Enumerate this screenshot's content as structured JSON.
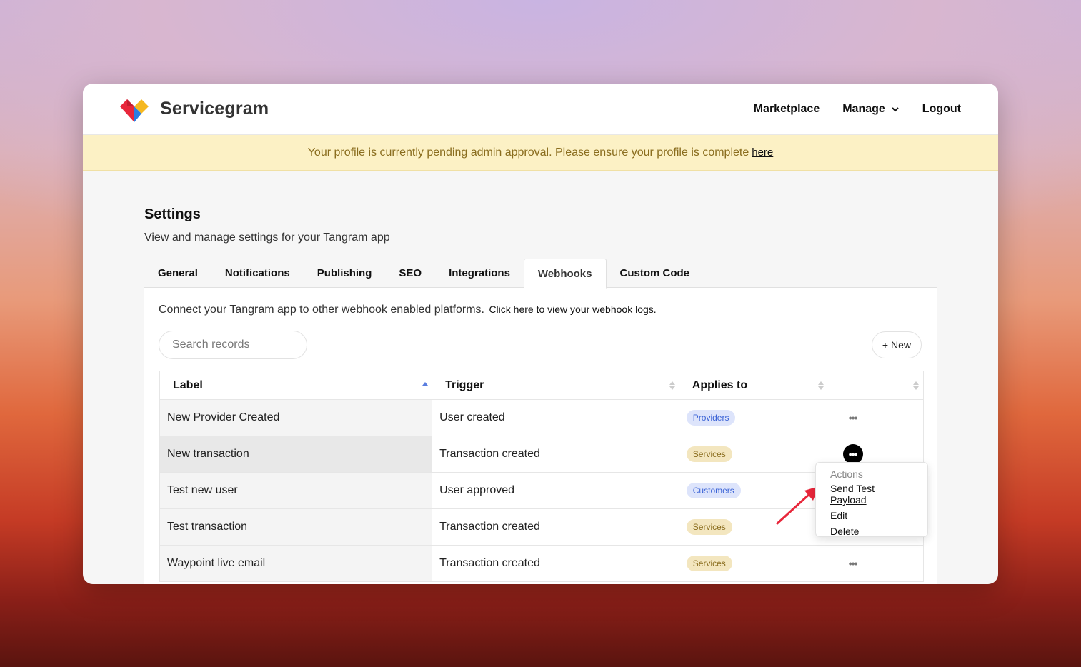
{
  "brand": {
    "name": "Servicegram"
  },
  "nav": {
    "marketplace": "Marketplace",
    "manage": "Manage",
    "logout": "Logout"
  },
  "banner": {
    "text": "Your profile is currently pending admin approval. Please ensure your profile is complete",
    "link": "here"
  },
  "page": {
    "title": "Settings",
    "subtitle": "View and manage settings for your Tangram app"
  },
  "tabs": [
    {
      "label": "General"
    },
    {
      "label": "Notifications"
    },
    {
      "label": "Publishing"
    },
    {
      "label": "SEO"
    },
    {
      "label": "Integrations"
    },
    {
      "label": "Webhooks",
      "active": true
    },
    {
      "label": "Custom Code"
    }
  ],
  "webhooks": {
    "intro": "Connect your Tangram app to other webhook enabled platforms.",
    "logs_link": "Click here to view your webhook logs.",
    "search_placeholder": "Search records",
    "new_button": "+ New",
    "columns": {
      "label": "Label",
      "trigger": "Trigger",
      "applies_to": "Applies to"
    },
    "rows": [
      {
        "label": "New Provider Created",
        "trigger": "User created",
        "applies_to": "Providers"
      },
      {
        "label": "New transaction",
        "trigger": "Transaction created",
        "applies_to": "Services"
      },
      {
        "label": "Test new user",
        "trigger": "User approved",
        "applies_to": "Customers"
      },
      {
        "label": "Test transaction",
        "trigger": "Transaction created",
        "applies_to": "Services"
      },
      {
        "label": "Waypoint live email",
        "trigger": "Transaction created",
        "applies_to": "Services"
      }
    ],
    "row_menu": "•••"
  },
  "actions_menu": {
    "header": "Actions",
    "send_test": "Send Test Payload",
    "edit": "Edit",
    "delete": "Delete"
  },
  "colors": {
    "banner_bg": "#fcf1c5",
    "badge_blue": "#3b63d6",
    "badge_gold": "#8a6d1e",
    "arrow": "#e8263a"
  }
}
